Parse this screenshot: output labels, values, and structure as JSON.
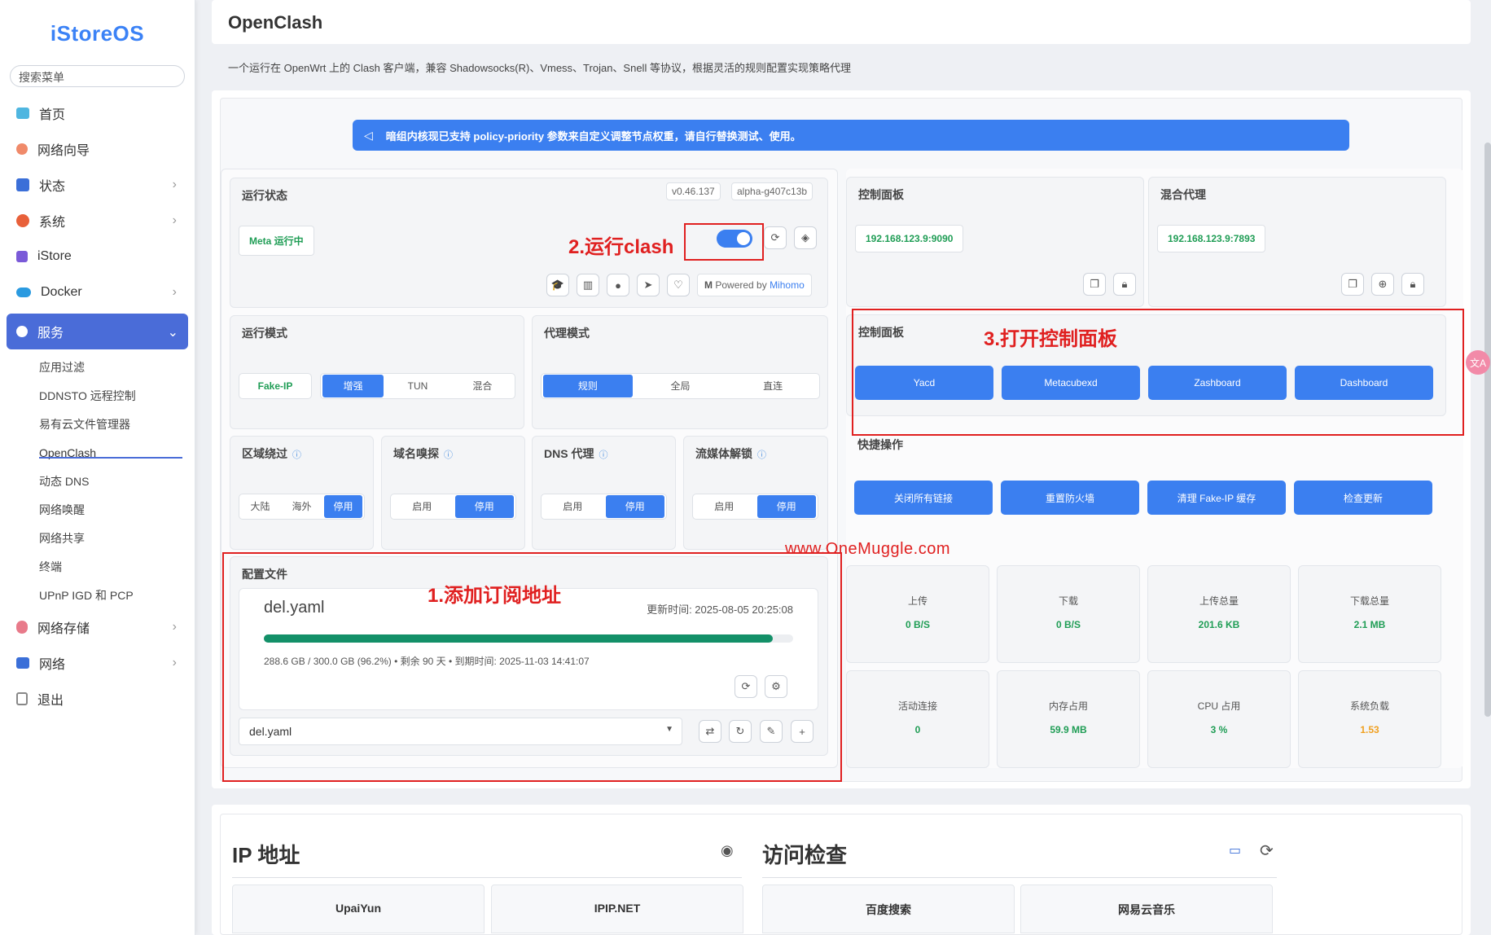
{
  "sidebar": {
    "logo": "iStoreOS",
    "search_placeholder": "搜索菜单",
    "items": [
      {
        "label": "首页"
      },
      {
        "label": "网络向导"
      },
      {
        "label": "状态"
      },
      {
        "label": "系统"
      },
      {
        "label": "iStore"
      },
      {
        "label": "Docker"
      },
      {
        "label": "服务"
      },
      {
        "label": "网络存储"
      },
      {
        "label": "网络"
      },
      {
        "label": "退出"
      }
    ],
    "sub_items": [
      {
        "label": "应用过滤"
      },
      {
        "label": "DDNSTO 远程控制"
      },
      {
        "label": "易有云文件管理器"
      },
      {
        "label": "OpenClash"
      },
      {
        "label": "动态 DNS"
      },
      {
        "label": "网络唤醒"
      },
      {
        "label": "网络共享"
      },
      {
        "label": "终端"
      },
      {
        "label": "UPnP IGD 和 PCP"
      }
    ]
  },
  "page": {
    "title": "OpenClash",
    "description": "一个运行在 OpenWrt 上的 Clash 客户端，兼容 Shadowsocks(R)、Vmess、Trojan、Snell 等协议，根据灵活的规则配置实现策略代理",
    "banner": "暗组内核现已支持 policy-priority 参数来自定义调整节点权重，请自行替换测试、使用。"
  },
  "run_status": {
    "title": "运行状态",
    "version": "v0.46.137",
    "core": "alpha-g407c13b",
    "status": "Meta 运行中",
    "toggle_on": true,
    "powered_by": "Powered by",
    "powered_name": "Mihomo"
  },
  "run_mode": {
    "title": "运行模式",
    "fake_ip": "Fake-IP",
    "options": [
      "增强",
      "TUN",
      "混合"
    ],
    "selected": "增强"
  },
  "proxy_mode": {
    "title": "代理模式",
    "options": [
      "规则",
      "全局",
      "直连"
    ],
    "selected": "规则"
  },
  "region_bypass": {
    "title": "区域绕过",
    "options": [
      "大陆",
      "海外",
      "停用"
    ],
    "selected": "停用"
  },
  "domain_sniff": {
    "title": "域名嗅探",
    "options": [
      "启用",
      "停用"
    ],
    "selected": "停用"
  },
  "dns_proxy": {
    "title": "DNS 代理",
    "options": [
      "启用",
      "停用"
    ],
    "selected": "停用"
  },
  "stream_unlock": {
    "title": "流媒体解锁",
    "options": [
      "启用",
      "停用"
    ],
    "selected": "停用"
  },
  "config": {
    "title": "配置文件",
    "filename": "del.yaml",
    "updated": "更新时间: 2025-08-05 20:25:08",
    "usage_percent": 96.2,
    "usage_text": "288.6 GB / 300.0 GB (96.2%) • 剩余 90 天 • 到期时间: 2025-11-03 14:41:07",
    "selected_file": "del.yaml"
  },
  "dashboard": {
    "title": "控制面板",
    "address": "192.168.123.9:9090"
  },
  "mixed_proxy": {
    "title": "混合代理",
    "address": "192.168.123.9:7893"
  },
  "panels": {
    "title": "控制面板",
    "buttons": [
      "Yacd",
      "Metacubexd",
      "Zashboard",
      "Dashboard"
    ]
  },
  "quick_actions": {
    "title": "快捷操作",
    "buttons": [
      "关闭所有链接",
      "重置防火墙",
      "清理 Fake-IP 缓存",
      "检查更新"
    ]
  },
  "stats": [
    {
      "label": "上传",
      "value": "0 B/S"
    },
    {
      "label": "下载",
      "value": "0 B/S"
    },
    {
      "label": "上传总量",
      "value": "201.6 KB"
    },
    {
      "label": "下载总量",
      "value": "2.1 MB"
    },
    {
      "label": "活动连接",
      "value": "0"
    },
    {
      "label": "内存占用",
      "value": "59.9 MB"
    },
    {
      "label": "CPU 占用",
      "value": "3 %"
    },
    {
      "label": "系统负载",
      "value": "1.53"
    }
  ],
  "annotations": {
    "step1": "1.添加订阅地址",
    "step2": "2.运行clash",
    "step3": "3.打开控制面板",
    "watermark": "www.OneMuggle.com"
  },
  "ip_section": {
    "title": "IP 地址",
    "cards": [
      "UpaiYun",
      "IPIP.NET"
    ]
  },
  "access_section": {
    "title": "访问检查",
    "cards": [
      "百度搜索",
      "网易云音乐"
    ]
  },
  "colors": {
    "accent": "#3b7ff0",
    "green": "#1f9d55",
    "annotation": "#e02020",
    "sidebar_active": "#4a6cd8"
  }
}
